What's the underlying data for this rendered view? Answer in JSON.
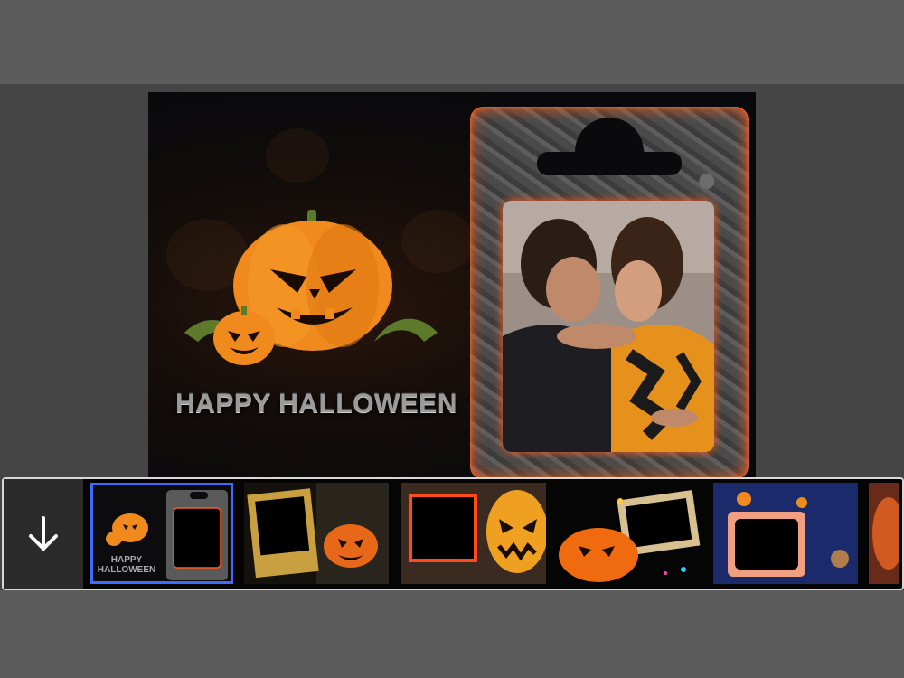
{
  "canvas": {
    "greeting": "HAPPY HALLOWEEN"
  },
  "toolbar": {
    "download_icon": "arrow-down-icon"
  },
  "frames": [
    {
      "id": "frame-1",
      "label": "HAPPY HALLOWEEN",
      "selected": true
    },
    {
      "id": "frame-2",
      "label": "",
      "selected": false
    },
    {
      "id": "frame-3",
      "label": "",
      "selected": false
    },
    {
      "id": "frame-4",
      "label": "",
      "selected": false
    },
    {
      "id": "frame-5",
      "label": "",
      "selected": false
    },
    {
      "id": "frame-6",
      "label": "",
      "selected": false
    }
  ],
  "colors": {
    "selection": "#3d6cff",
    "lava_glow": "#ff5a1a",
    "pumpkin": "#f08a1c"
  }
}
